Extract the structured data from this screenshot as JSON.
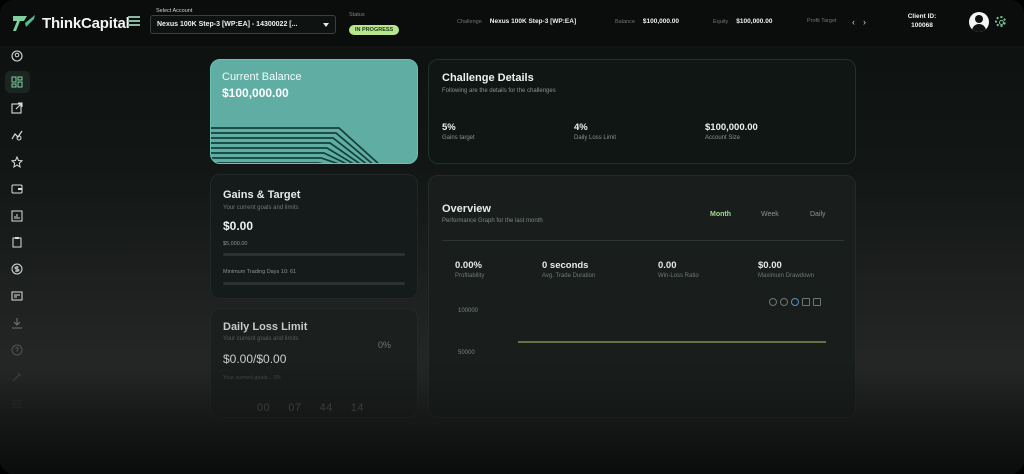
{
  "app": {
    "name": "ThinkCapital"
  },
  "header": {
    "select_label": "Select Account",
    "select_value": "Nexus 100K Step-3 [WP:EA] - 14300022 [...",
    "status_label": "Status",
    "status_value": "IN PROGRESS",
    "challenge_label": "Challenge",
    "challenge_value": "Nexus 100K Step-3 [WP:EA]",
    "balance_label": "Balance",
    "balance_value": "$100,000.00",
    "equity_label": "Equity",
    "equity_value": "$100,000.00",
    "profit_target_label": "Profit Target",
    "prev_arrow": "‹",
    "next_arrow": "›",
    "client_id_label": "Client ID:",
    "client_id_value": "100068"
  },
  "sidebar": {
    "items": [
      {
        "icon": "user-circle-icon"
      },
      {
        "icon": "dashboard-icon",
        "active": true
      },
      {
        "icon": "external-link-icon"
      },
      {
        "icon": "analytics-icon"
      },
      {
        "icon": "star-icon"
      },
      {
        "icon": "wallet-icon"
      },
      {
        "icon": "report-icon"
      },
      {
        "icon": "clipboard-icon"
      },
      {
        "icon": "dollar-icon"
      },
      {
        "icon": "certificate-icon"
      },
      {
        "icon": "download-icon"
      },
      {
        "icon": "help-icon"
      },
      {
        "icon": "tools-icon"
      },
      {
        "icon": "list-icon"
      }
    ]
  },
  "current_balance": {
    "title": "Current Balance",
    "value": "$100,000.00"
  },
  "challenge_details": {
    "title": "Challenge Details",
    "subtitle": "Following are the details for the challenges",
    "metrics": [
      {
        "value": "5%",
        "label": "Gains target"
      },
      {
        "value": "4%",
        "label": "Daily Loss Limit"
      },
      {
        "value": "$100,000.00",
        "label": "Account Size"
      }
    ]
  },
  "gains_target": {
    "title": "Gains & Target",
    "subtitle": "Your current goals and limits",
    "value": "$0.00",
    "target": "$5,000.00",
    "min_days": "Minimum Trading Days 10: 61",
    "progress": 0
  },
  "daily_loss": {
    "title": "Daily Loss Limit",
    "subtitle": "Your current goals and limits",
    "percent": "0%",
    "value": "$0.00/$0.00",
    "reset_text": "Your current goals... 00:",
    "countdown": [
      "00",
      "07",
      "44",
      "14"
    ]
  },
  "overview": {
    "title": "Overview",
    "subtitle": "Performance Graph for the last month",
    "tabs": [
      {
        "label": "Month",
        "active": true
      },
      {
        "label": "Week",
        "active": false
      },
      {
        "label": "Daily",
        "active": false
      }
    ],
    "metrics": [
      {
        "value": "0.00%",
        "label": "Profitability"
      },
      {
        "value": "0 seconds",
        "label": "Avg. Trade Duration"
      },
      {
        "value": "0.00",
        "label": "Win-Loss Ratio"
      },
      {
        "value": "$0.00",
        "label": "Maximum Drawdown"
      }
    ],
    "toolbar_icons": [
      "zoom-in-icon",
      "zoom-out-icon",
      "search-icon",
      "pan-icon",
      "home-icon"
    ]
  },
  "chart_data": {
    "type": "line",
    "title": "",
    "xlabel": "",
    "ylabel": "",
    "y_ticks": [
      "100000",
      "50000"
    ],
    "series": [
      {
        "values": [
          100000,
          100000
        ]
      }
    ]
  },
  "colors": {
    "accent_green": "#a9d98f",
    "status_badge": "#b9e58e",
    "balance_card": "#5fada3",
    "chart_line": "#b9c46a"
  }
}
